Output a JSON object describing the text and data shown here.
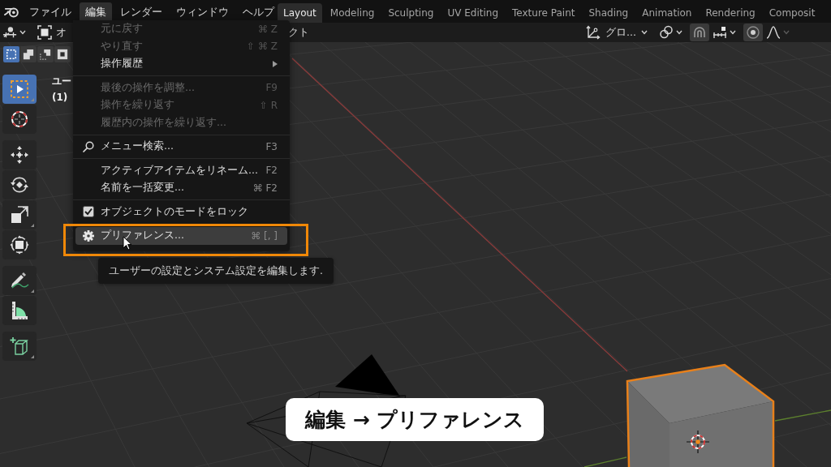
{
  "top_bar": {
    "menus": [
      {
        "label": "ファイル",
        "selected": false
      },
      {
        "label": "編集",
        "selected": true
      },
      {
        "label": "レンダー",
        "selected": false
      },
      {
        "label": "ウィンドウ",
        "selected": false
      },
      {
        "label": "ヘルプ",
        "selected": false
      }
    ],
    "workspaces": [
      {
        "label": "Layout",
        "selected": true
      },
      {
        "label": "Modeling",
        "selected": false
      },
      {
        "label": "Sculpting",
        "selected": false
      },
      {
        "label": "UV Editing",
        "selected": false
      },
      {
        "label": "Texture Paint",
        "selected": false
      },
      {
        "label": "Shading",
        "selected": false
      },
      {
        "label": "Animation",
        "selected": false
      },
      {
        "label": "Rendering",
        "selected": false
      },
      {
        "label": "Composit",
        "selected": false
      }
    ]
  },
  "header": {
    "left_fragment": "オ",
    "right_fragment": "クト",
    "orientation": "グロ...",
    "select_modes": [
      {
        "selected": true
      },
      {
        "selected": false
      },
      {
        "selected": false
      },
      {
        "selected": false
      }
    ]
  },
  "toolbar": {
    "groups": [
      {
        "tools": [
          {
            "selected": true
          },
          {
            "selected": false
          }
        ]
      },
      {
        "tools": [
          {
            "selected": false
          },
          {
            "selected": false
          },
          {
            "selected": false
          },
          {
            "selected": false
          }
        ]
      },
      {
        "tools": [
          {
            "selected": false
          },
          {
            "selected": false
          }
        ]
      },
      {
        "tools": [
          {
            "selected": false
          }
        ]
      }
    ]
  },
  "viewport": {
    "overlay_lines": [
      "ユー",
      "(1)"
    ]
  },
  "edit_menu": {
    "items": [
      {
        "kind": "plain",
        "label": "元に戻す",
        "shortcut": "⌘ Z",
        "disabled": true,
        "submenu": false,
        "highlighted": false
      },
      {
        "kind": "plain",
        "label": "やり直す",
        "shortcut": "⇧ ⌘ Z",
        "disabled": true,
        "submenu": false,
        "highlighted": false
      },
      {
        "kind": "plain",
        "label": "操作履歴",
        "disabled": false,
        "submenu": true,
        "highlighted": false
      },
      {
        "kind": "separator"
      },
      {
        "kind": "plain",
        "label": "最後の操作を調整...",
        "shortcut": "F9",
        "disabled": true,
        "submenu": false,
        "highlighted": false
      },
      {
        "kind": "plain",
        "label": "操作を繰り返す",
        "shortcut": "⇧ R",
        "disabled": true,
        "submenu": false,
        "highlighted": false
      },
      {
        "kind": "plain",
        "label": "履歴内の操作を繰り返す...",
        "disabled": true,
        "submenu": false,
        "highlighted": false
      },
      {
        "kind": "separator"
      },
      {
        "kind": "search",
        "label": "メニュー検索...",
        "shortcut": "F3",
        "disabled": false,
        "submenu": false,
        "highlighted": false
      },
      {
        "kind": "separator"
      },
      {
        "kind": "plain",
        "label": "アクティブアイテムをリネーム...",
        "shortcut": "F2",
        "disabled": false,
        "submenu": false,
        "highlighted": false
      },
      {
        "kind": "plain",
        "label": "名前を一括変更...",
        "shortcut": "⌘ F2",
        "disabled": false,
        "submenu": false,
        "highlighted": false
      },
      {
        "kind": "separator"
      },
      {
        "kind": "checkbox",
        "label": "オブジェクトのモードをロック",
        "checked": true,
        "disabled": false,
        "submenu": false,
        "highlighted": false
      },
      {
        "kind": "separator"
      },
      {
        "kind": "settings",
        "label": "プリファレンス...",
        "shortcut": "⌘ [, ]",
        "disabled": false,
        "submenu": false,
        "highlighted": true
      }
    ]
  },
  "tooltip": {
    "text": "ユーザーの設定とシステム設定を編集します."
  },
  "caption": {
    "text": "編集 → プリファレンス"
  }
}
